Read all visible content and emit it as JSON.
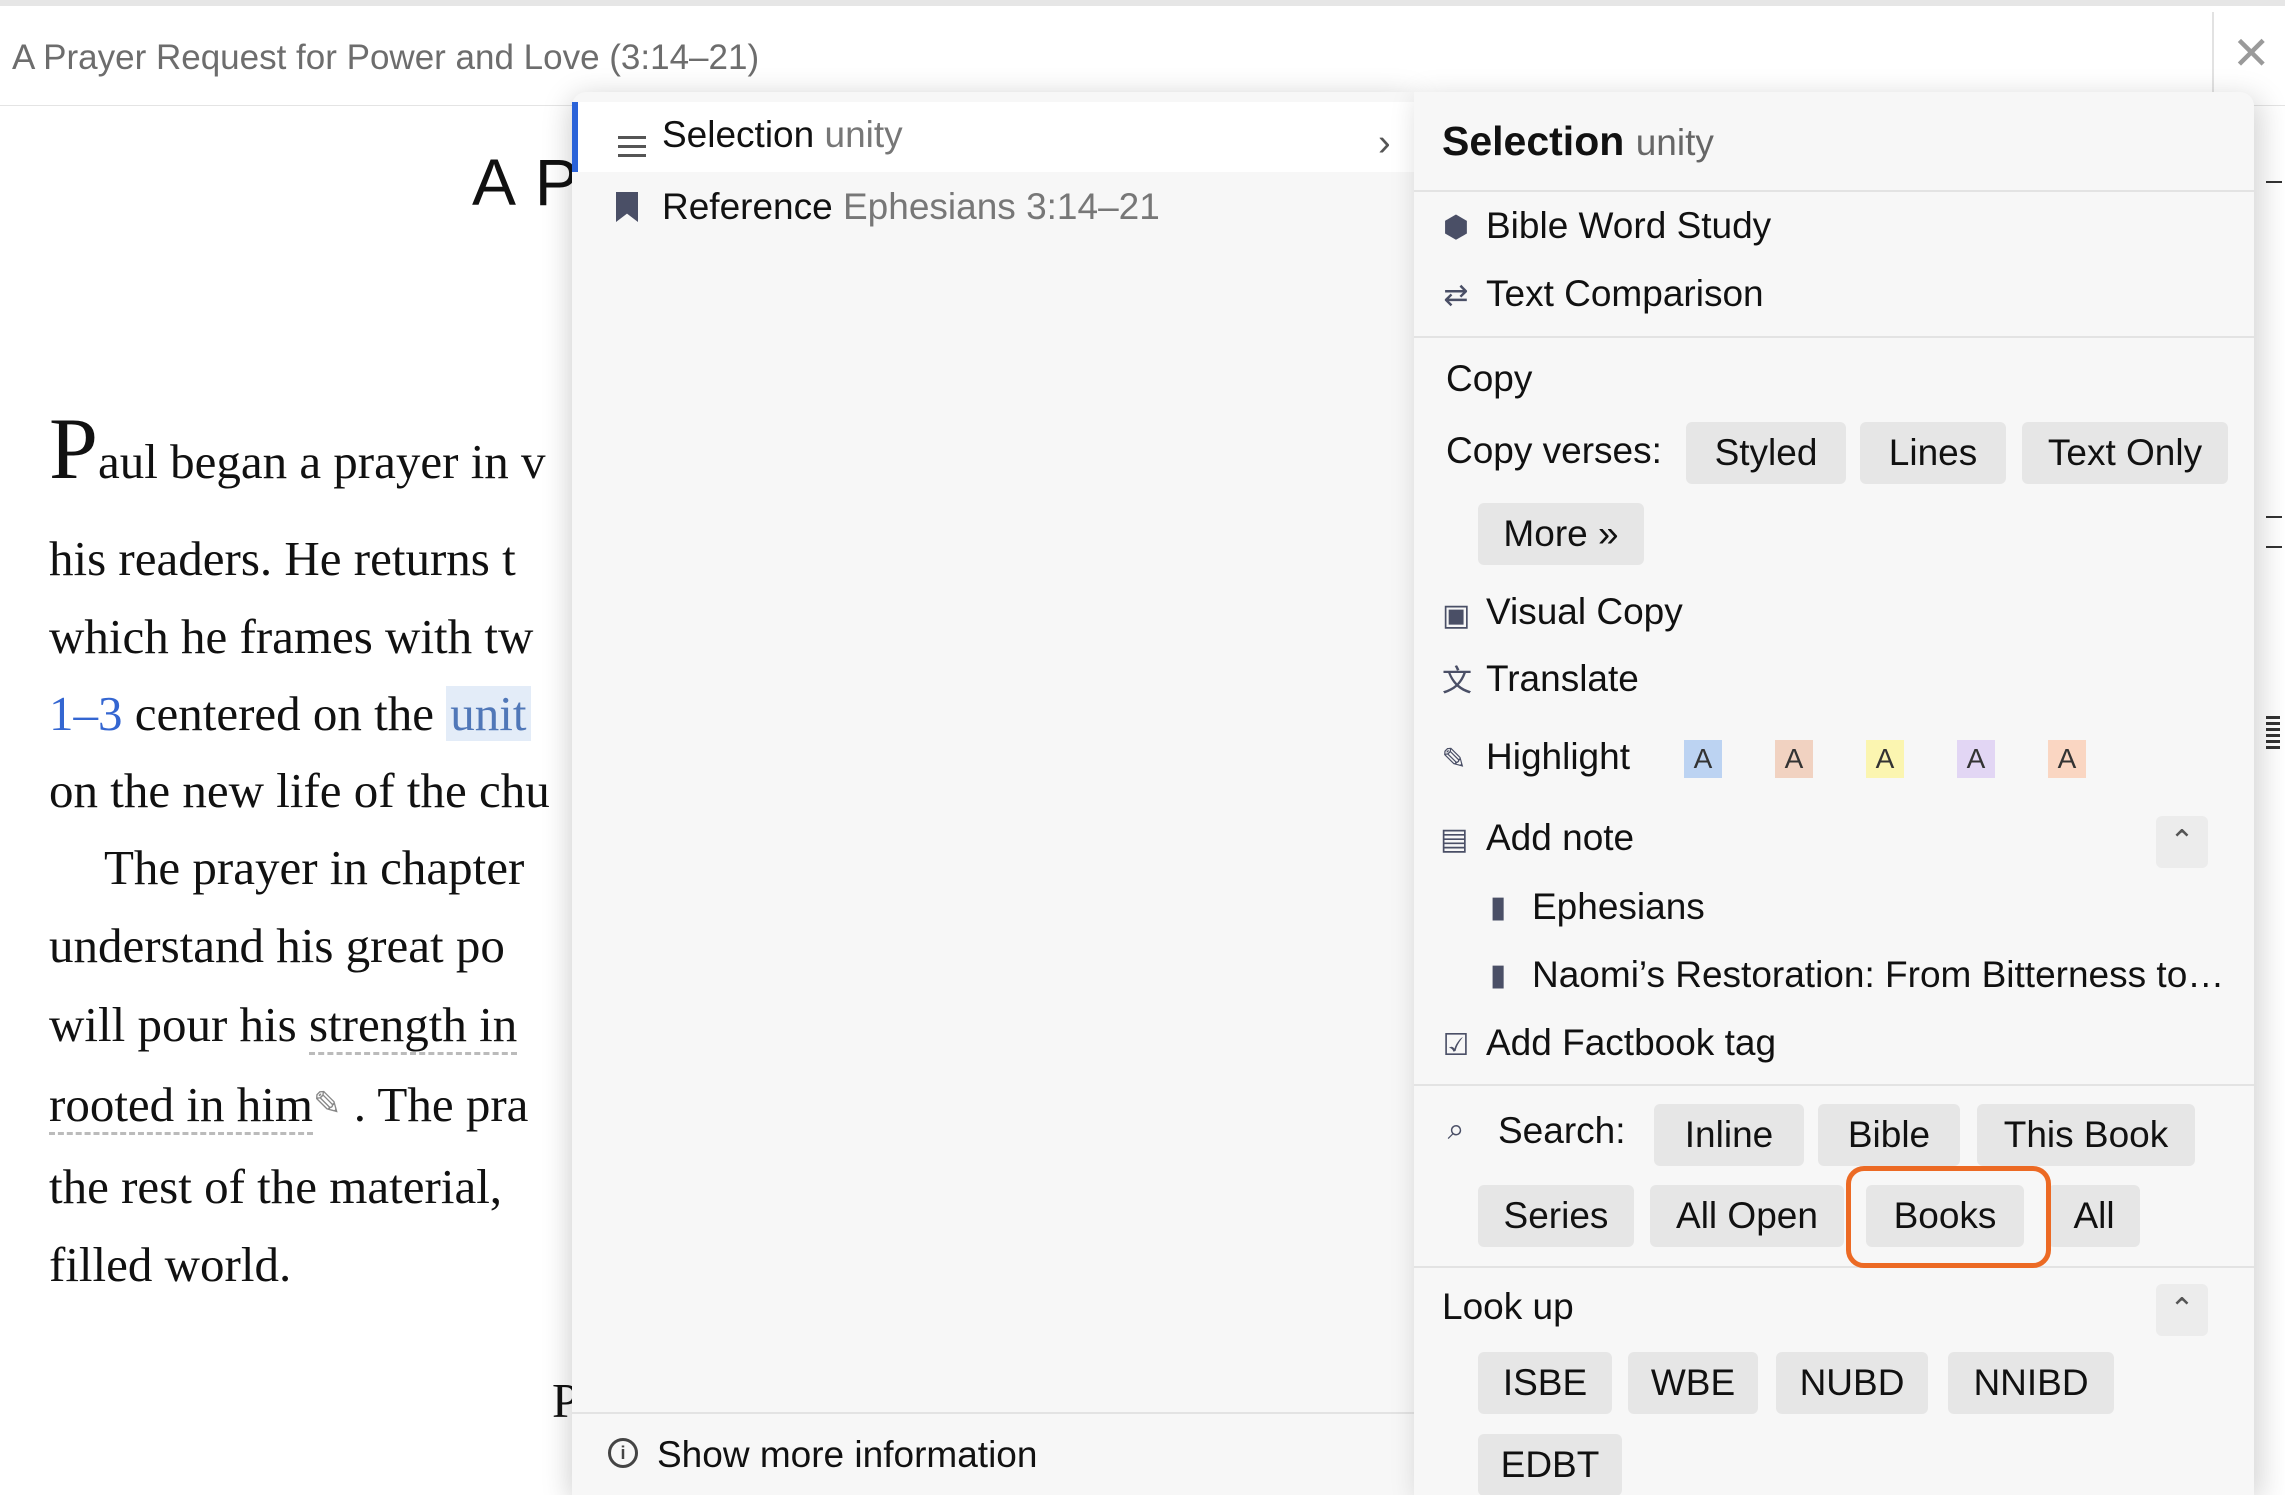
{
  "window": {
    "title": "A Prayer Request for Power and Love (3:14–21)",
    "close_glyph": "✕"
  },
  "document": {
    "heading": "A P",
    "dropcap": "P",
    "lines": [
      "aul began a prayer in v",
      "his readers. He returns t",
      "which he frames with tw",
      "centered on the",
      "on the new life of the chu",
      "The prayer in chapter",
      "understand his great po",
      "will pour his",
      ". The pra",
      "the rest of the material,",
      "filled world."
    ],
    "link_ref": "1–3",
    "highlight_word": "unit",
    "dashed_word_1": "strength in",
    "dashed_word_2": "rooted in him",
    "bottom_letter": "P"
  },
  "context_menu": {
    "selection_label": "Selection",
    "selection_value": "unity",
    "reference_label": "Reference",
    "reference_value": "Ephesians 3:14–21",
    "show_more": "Show more information"
  },
  "panel": {
    "header_label": "Selection",
    "header_value": "unity",
    "bible_word_study": "Bible Word Study",
    "text_comparison": "Text Comparison",
    "copy_heading": "Copy",
    "copy_verses_label": "Copy verses:",
    "copy_buttons": [
      "Styled",
      "Lines",
      "Text Only",
      "More »"
    ],
    "visual_copy": "Visual Copy",
    "translate": "Translate",
    "highlight": "Highlight",
    "highlight_swatches": [
      {
        "letter": "A",
        "color": "#bcd3f2"
      },
      {
        "letter": "A",
        "color": "#f1d2c1"
      },
      {
        "letter": "A",
        "color": "#fbf5b0"
      },
      {
        "letter": "A",
        "color": "#e2d6f4"
      },
      {
        "letter": "A",
        "color": "#fad6c2"
      }
    ],
    "add_note": "Add note",
    "notebooks": [
      "Ephesians",
      "Naomi’s Restoration: From Bitterness to…"
    ],
    "add_factbook_tag": "Add Factbook tag",
    "search_label": "Search:",
    "search_buttons": [
      "Inline",
      "Bible",
      "This Book",
      "Series",
      "All Open",
      "Books",
      "All"
    ],
    "look_up": "Look up",
    "lookup_buttons": [
      "ISBE",
      "WBE",
      "NUBD",
      "NNIBD",
      "EDBT"
    ],
    "focus_color": "#ec6a24"
  }
}
